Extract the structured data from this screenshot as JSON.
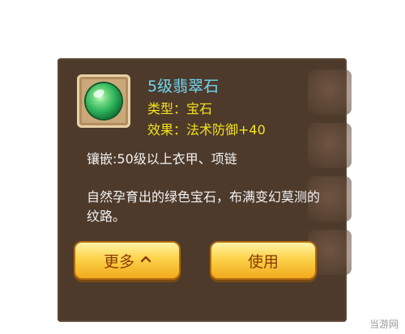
{
  "item": {
    "name": "5级翡翠石",
    "type_line": "类型：宝石",
    "effect_line": "效果：法术防御+40",
    "icon": "green-gem-icon"
  },
  "description": {
    "socket": "镶嵌:50级以上衣甲、项链",
    "lore": "自然孕育出的绿色宝石，布满变幻莫测的纹路。"
  },
  "buttons": {
    "more_label": "更多",
    "use_label": "使用"
  },
  "watermark": "当游网",
  "colors": {
    "panel": "#4d3a2b",
    "name": "#6ed7f4",
    "stats": "#f4e21c",
    "button": "#fcd34a"
  }
}
